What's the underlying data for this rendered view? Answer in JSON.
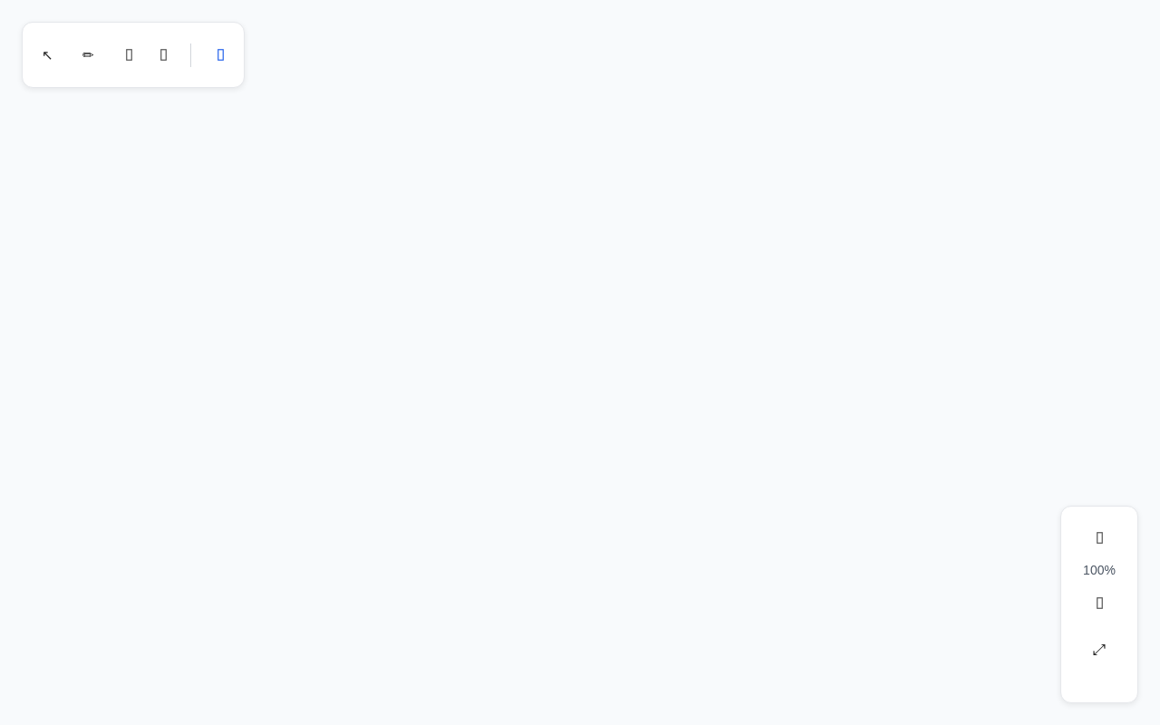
{
  "toolbar": {
    "tools": [
      {
        "kind": "glyph",
        "glyph": "↖",
        "selected": false
      },
      {
        "kind": "box",
        "selected": false
      },
      {
        "kind": "box",
        "selected": false
      }
    ],
    "pen": {
      "glyph": "✏"
    },
    "toggle": {
      "kind": "box",
      "on": true
    }
  },
  "zoom_panel": {
    "zoom_in": {
      "kind": "box"
    },
    "level_text": "100%",
    "zoom_out": {
      "kind": "box"
    },
    "fit": {
      "kind": "glyph",
      "glyph": "⤢"
    }
  }
}
